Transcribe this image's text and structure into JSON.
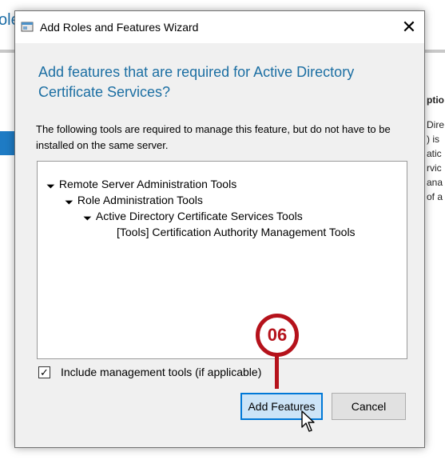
{
  "background": {
    "title_fragment": "ole",
    "heading_fragment": "ptio",
    "lines": [
      "Dire",
      ") is",
      "atic",
      "rvic",
      "ana",
      "of a"
    ]
  },
  "dialog": {
    "title": "Add Roles and Features Wizard",
    "close_glyph": "✕",
    "heading": "Add features that are required for Active Directory Certificate Services?",
    "description": "The following tools are required to manage this feature, but do not have to be installed on the same server.",
    "tree": [
      {
        "label": "Remote Server Administration Tools",
        "expanded": true
      },
      {
        "label": "Role Administration Tools",
        "expanded": true
      },
      {
        "label": "Active Directory Certificate Services Tools",
        "expanded": true
      },
      {
        "label": "[Tools] Certification Authority Management Tools",
        "expanded": false
      }
    ],
    "checkbox": {
      "label": "Include management tools (if applicable)",
      "checked": true,
      "glyph": "✓"
    },
    "buttons": {
      "add_features": "Add Features",
      "cancel": "Cancel"
    }
  },
  "callout": {
    "number": "06",
    "color": "#b5121b"
  },
  "colors": {
    "heading": "#1c6fa3",
    "button_focus_border": "#0078d7",
    "button_focus_fill": "#cce4f7"
  }
}
